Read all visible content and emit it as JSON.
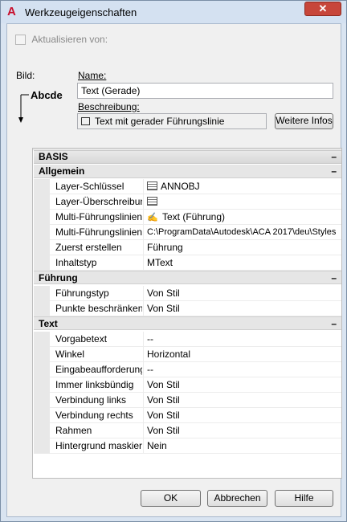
{
  "window": {
    "title": "Werkzeugeigenschaften",
    "close_glyph": "✕"
  },
  "header": {
    "update_from_label": "Aktualisieren von:",
    "image_label": "Bild:",
    "name_label": "Name:",
    "name_value": "Text (Gerade)",
    "description_label": "Beschreibung:",
    "description_value": "Text mit gerader Führungslinie",
    "more_info_label": "Weitere Infos",
    "preview_text": "Abcde"
  },
  "grid": {
    "basis_label": "BASIS",
    "general_label": "Allgemein",
    "leader_label": "Führung",
    "text_label": "Text",
    "collapse_glyph": "–",
    "general_props": [
      {
        "name": "Layer-Schlüssel",
        "value": "ANNOBJ",
        "icon": "layer-grid-icon"
      },
      {
        "name": "Layer-Überschreibungen",
        "value": "",
        "icon": "layer-grid-icon"
      },
      {
        "name": "Multi-Führungslinienstil",
        "value": "Text (Führung)",
        "icon": "leader-style-icon"
      },
      {
        "name": "Multi-Führungslinienstil-Pfad",
        "value": "C:\\ProgramData\\Autodesk\\ACA 2017\\deu\\Styles"
      },
      {
        "name": "Zuerst erstellen",
        "value": "Führung"
      },
      {
        "name": "Inhaltstyp",
        "value": "MText"
      }
    ],
    "leader_props": [
      {
        "name": "Führungstyp",
        "value": "Von Stil"
      },
      {
        "name": "Punkte beschränken",
        "value": "Von Stil"
      }
    ],
    "text_props": [
      {
        "name": "Vorgabetext",
        "value": "--"
      },
      {
        "name": "Winkel",
        "value": "Horizontal"
      },
      {
        "name": "Eingabeaufforderung",
        "value": "--"
      },
      {
        "name": "Immer linksbündig",
        "value": "Von Stil"
      },
      {
        "name": "Verbindung links",
        "value": "Von Stil"
      },
      {
        "name": "Verbindung rechts",
        "value": "Von Stil"
      },
      {
        "name": "Rahmen",
        "value": "Von Stil"
      },
      {
        "name": "Hintergrund maskieren",
        "value": "Nein"
      }
    ]
  },
  "footer": {
    "ok_label": "OK",
    "cancel_label": "Abbrechen",
    "help_label": "Hilfe"
  },
  "colors": {
    "title_bg": "#d4e1f1",
    "close_btn": "#c7463a",
    "autodesk_red": "#c8102e"
  }
}
